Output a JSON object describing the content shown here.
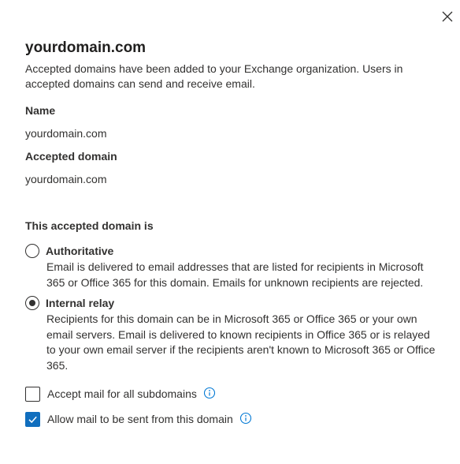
{
  "panel": {
    "title": "yourdomain.com",
    "description": "Accepted domains have been added to your Exchange organization. Users in accepted domains can send and receive email.",
    "name_label": "Name",
    "name_value": "yourdomain.com",
    "accepted_domain_label": "Accepted domain",
    "accepted_domain_value": "yourdomain.com",
    "domain_type_label": "This accepted domain is",
    "options": [
      {
        "label": "Authoritative",
        "description": "Email is delivered to email addresses that are listed for recipients in Microsoft 365 or Office 365 for this domain. Emails for unknown recipients are rejected.",
        "selected": false
      },
      {
        "label": "Internal relay",
        "description": "Recipients for this domain can be in Microsoft 365 or Office 365 or your own email servers. Email is delivered to known recipients in Office 365 or is relayed to your own email server if the recipients aren't known to Microsoft 365 or Office 365.",
        "selected": true
      }
    ],
    "checkboxes": [
      {
        "label": "Accept mail for all subdomains",
        "checked": false
      },
      {
        "label": "Allow mail to be sent from this domain",
        "checked": true
      }
    ]
  },
  "icons": {
    "close": "close-icon",
    "info": "info-icon",
    "check": "checkmark-icon"
  },
  "colors": {
    "accent": "#106ebe",
    "text": "#323130",
    "info": "#0078d4"
  }
}
